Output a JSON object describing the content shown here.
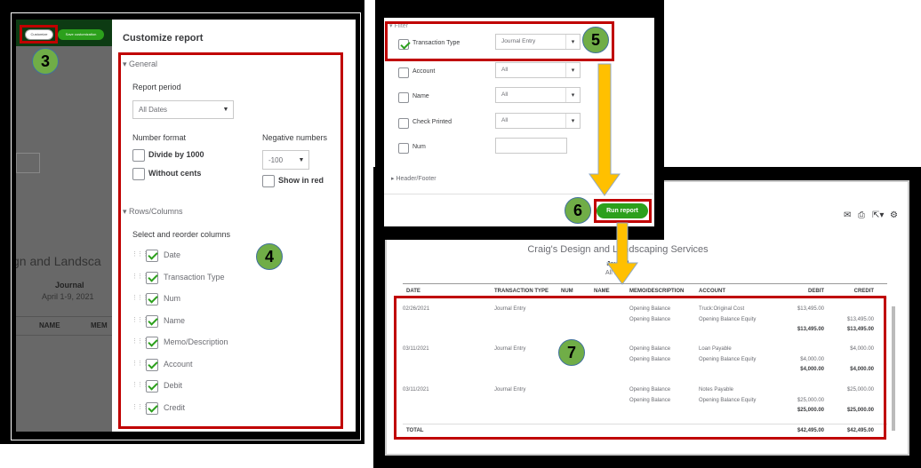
{
  "panel_a": {
    "customize_label": "Customize",
    "save_customization_label": "Save customization",
    "step": "3",
    "step_columns": "4",
    "bg_report": {
      "company_partial": "gn and Landsca",
      "title": "Journal",
      "period": "April 1-9, 2021",
      "col_name": "NAME",
      "col_memo": "MEM"
    },
    "title": "Customize report",
    "general": {
      "label": "General",
      "report_period_label": "Report period",
      "report_period_value": "All Dates",
      "number_format_label": "Number format",
      "divide_by_1000": "Divide by 1000",
      "without_cents": "Without cents",
      "negative_numbers_label": "Negative numbers",
      "negative_numbers_value": "-100",
      "show_in_red": "Show in red"
    },
    "rows_columns": {
      "label": "Rows/Columns",
      "select_label": "Select and reorder columns",
      "columns": [
        "Date",
        "Transaction Type",
        "Num",
        "Name",
        "Memo/Description",
        "Account",
        "Debit",
        "Credit"
      ]
    }
  },
  "panel_b": {
    "filter_label": "Filter",
    "step": "5",
    "step_run": "6",
    "filters": [
      {
        "label": "Transaction Type",
        "checked": true,
        "value": "Journal Entry"
      },
      {
        "label": "Account",
        "checked": false,
        "value": "All"
      },
      {
        "label": "Name",
        "checked": false,
        "value": "All"
      },
      {
        "label": "Check Printed",
        "checked": false,
        "value": "All"
      },
      {
        "label": "Num",
        "checked": false,
        "value": ""
      }
    ],
    "header_footer_label": "Header/Footer",
    "run_report_label": "Run report"
  },
  "panel_c": {
    "step": "7",
    "company": "Craig's Design and Landscaping Services",
    "report_title": "Journal",
    "report_period": "All Dates",
    "columns": [
      "DATE",
      "TRANSACTION TYPE",
      "NUM",
      "NAME",
      "MEMO/DESCRIPTION",
      "ACCOUNT",
      "DEBIT",
      "CREDIT"
    ],
    "groups": [
      {
        "date": "02/26/2021",
        "type": "Journal Entry",
        "lines": [
          {
            "memo": "Opening Balance",
            "account": "Truck:Original Cost",
            "debit": "$13,495.00",
            "credit": ""
          },
          {
            "memo": "Opening Balance",
            "account": "Opening Balance Equity",
            "debit": "",
            "credit": "$13,495.00"
          }
        ],
        "total_debit": "$13,495.00",
        "total_credit": "$13,495.00"
      },
      {
        "date": "03/11/2021",
        "type": "Journal Entry",
        "lines": [
          {
            "memo": "Opening Balance",
            "account": "Loan Payable",
            "debit": "",
            "credit": "$4,000.00"
          },
          {
            "memo": "Opening Balance",
            "account": "Opening Balance Equity",
            "debit": "$4,000.00",
            "credit": ""
          }
        ],
        "total_debit": "$4,000.00",
        "total_credit": "$4,000.00"
      },
      {
        "date": "03/11/2021",
        "type": "Journal Entry",
        "lines": [
          {
            "memo": "Opening Balance",
            "account": "Notes Payable",
            "debit": "",
            "credit": "$25,000.00"
          },
          {
            "memo": "Opening Balance",
            "account": "Opening Balance Equity",
            "debit": "$25,000.00",
            "credit": ""
          }
        ],
        "total_debit": "$25,000.00",
        "total_credit": "$25,000.00"
      }
    ],
    "total_label": "TOTAL",
    "total_debit": "$42,495.00",
    "total_credit": "$42,495.00",
    "icons": [
      "email-icon",
      "print-icon",
      "export-icon",
      "gear-icon"
    ]
  },
  "colors": {
    "accent_green": "#2ca01c",
    "annotation_red": "#c00000",
    "badge_green": "#70ad47",
    "arrow_yellow": "#ffc000"
  }
}
